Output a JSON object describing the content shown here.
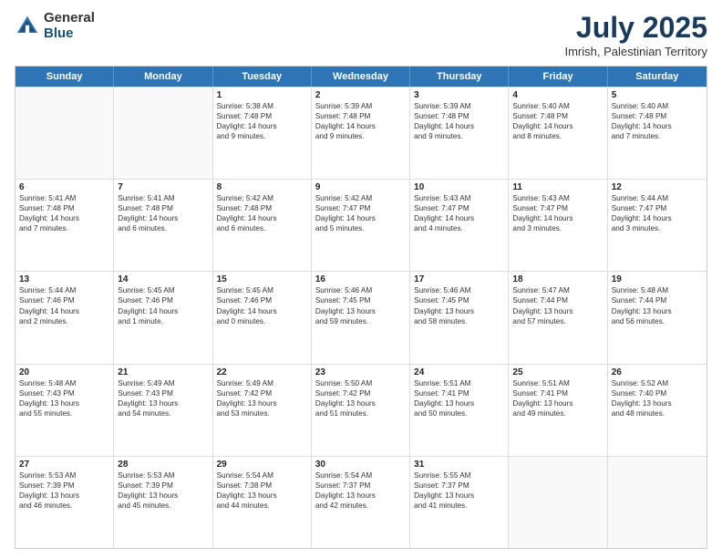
{
  "logo": {
    "general": "General",
    "blue": "Blue"
  },
  "title": "July 2025",
  "subtitle": "Imrish, Palestinian Territory",
  "headers": [
    "Sunday",
    "Monday",
    "Tuesday",
    "Wednesday",
    "Thursday",
    "Friday",
    "Saturday"
  ],
  "weeks": [
    [
      {
        "day": "",
        "lines": []
      },
      {
        "day": "",
        "lines": []
      },
      {
        "day": "1",
        "lines": [
          "Sunrise: 5:38 AM",
          "Sunset: 7:48 PM",
          "Daylight: 14 hours",
          "and 9 minutes."
        ]
      },
      {
        "day": "2",
        "lines": [
          "Sunrise: 5:39 AM",
          "Sunset: 7:48 PM",
          "Daylight: 14 hours",
          "and 9 minutes."
        ]
      },
      {
        "day": "3",
        "lines": [
          "Sunrise: 5:39 AM",
          "Sunset: 7:48 PM",
          "Daylight: 14 hours",
          "and 9 minutes."
        ]
      },
      {
        "day": "4",
        "lines": [
          "Sunrise: 5:40 AM",
          "Sunset: 7:48 PM",
          "Daylight: 14 hours",
          "and 8 minutes."
        ]
      },
      {
        "day": "5",
        "lines": [
          "Sunrise: 5:40 AM",
          "Sunset: 7:48 PM",
          "Daylight: 14 hours",
          "and 7 minutes."
        ]
      }
    ],
    [
      {
        "day": "6",
        "lines": [
          "Sunrise: 5:41 AM",
          "Sunset: 7:48 PM",
          "Daylight: 14 hours",
          "and 7 minutes."
        ]
      },
      {
        "day": "7",
        "lines": [
          "Sunrise: 5:41 AM",
          "Sunset: 7:48 PM",
          "Daylight: 14 hours",
          "and 6 minutes."
        ]
      },
      {
        "day": "8",
        "lines": [
          "Sunrise: 5:42 AM",
          "Sunset: 7:48 PM",
          "Daylight: 14 hours",
          "and 6 minutes."
        ]
      },
      {
        "day": "9",
        "lines": [
          "Sunrise: 5:42 AM",
          "Sunset: 7:47 PM",
          "Daylight: 14 hours",
          "and 5 minutes."
        ]
      },
      {
        "day": "10",
        "lines": [
          "Sunrise: 5:43 AM",
          "Sunset: 7:47 PM",
          "Daylight: 14 hours",
          "and 4 minutes."
        ]
      },
      {
        "day": "11",
        "lines": [
          "Sunrise: 5:43 AM",
          "Sunset: 7:47 PM",
          "Daylight: 14 hours",
          "and 3 minutes."
        ]
      },
      {
        "day": "12",
        "lines": [
          "Sunrise: 5:44 AM",
          "Sunset: 7:47 PM",
          "Daylight: 14 hours",
          "and 3 minutes."
        ]
      }
    ],
    [
      {
        "day": "13",
        "lines": [
          "Sunrise: 5:44 AM",
          "Sunset: 7:46 PM",
          "Daylight: 14 hours",
          "and 2 minutes."
        ]
      },
      {
        "day": "14",
        "lines": [
          "Sunrise: 5:45 AM",
          "Sunset: 7:46 PM",
          "Daylight: 14 hours",
          "and 1 minute."
        ]
      },
      {
        "day": "15",
        "lines": [
          "Sunrise: 5:45 AM",
          "Sunset: 7:46 PM",
          "Daylight: 14 hours",
          "and 0 minutes."
        ]
      },
      {
        "day": "16",
        "lines": [
          "Sunrise: 5:46 AM",
          "Sunset: 7:45 PM",
          "Daylight: 13 hours",
          "and 59 minutes."
        ]
      },
      {
        "day": "17",
        "lines": [
          "Sunrise: 5:46 AM",
          "Sunset: 7:45 PM",
          "Daylight: 13 hours",
          "and 58 minutes."
        ]
      },
      {
        "day": "18",
        "lines": [
          "Sunrise: 5:47 AM",
          "Sunset: 7:44 PM",
          "Daylight: 13 hours",
          "and 57 minutes."
        ]
      },
      {
        "day": "19",
        "lines": [
          "Sunrise: 5:48 AM",
          "Sunset: 7:44 PM",
          "Daylight: 13 hours",
          "and 56 minutes."
        ]
      }
    ],
    [
      {
        "day": "20",
        "lines": [
          "Sunrise: 5:48 AM",
          "Sunset: 7:43 PM",
          "Daylight: 13 hours",
          "and 55 minutes."
        ]
      },
      {
        "day": "21",
        "lines": [
          "Sunrise: 5:49 AM",
          "Sunset: 7:43 PM",
          "Daylight: 13 hours",
          "and 54 minutes."
        ]
      },
      {
        "day": "22",
        "lines": [
          "Sunrise: 5:49 AM",
          "Sunset: 7:42 PM",
          "Daylight: 13 hours",
          "and 53 minutes."
        ]
      },
      {
        "day": "23",
        "lines": [
          "Sunrise: 5:50 AM",
          "Sunset: 7:42 PM",
          "Daylight: 13 hours",
          "and 51 minutes."
        ]
      },
      {
        "day": "24",
        "lines": [
          "Sunrise: 5:51 AM",
          "Sunset: 7:41 PM",
          "Daylight: 13 hours",
          "and 50 minutes."
        ]
      },
      {
        "day": "25",
        "lines": [
          "Sunrise: 5:51 AM",
          "Sunset: 7:41 PM",
          "Daylight: 13 hours",
          "and 49 minutes."
        ]
      },
      {
        "day": "26",
        "lines": [
          "Sunrise: 5:52 AM",
          "Sunset: 7:40 PM",
          "Daylight: 13 hours",
          "and 48 minutes."
        ]
      }
    ],
    [
      {
        "day": "27",
        "lines": [
          "Sunrise: 5:53 AM",
          "Sunset: 7:39 PM",
          "Daylight: 13 hours",
          "and 46 minutes."
        ]
      },
      {
        "day": "28",
        "lines": [
          "Sunrise: 5:53 AM",
          "Sunset: 7:39 PM",
          "Daylight: 13 hours",
          "and 45 minutes."
        ]
      },
      {
        "day": "29",
        "lines": [
          "Sunrise: 5:54 AM",
          "Sunset: 7:38 PM",
          "Daylight: 13 hours",
          "and 44 minutes."
        ]
      },
      {
        "day": "30",
        "lines": [
          "Sunrise: 5:54 AM",
          "Sunset: 7:37 PM",
          "Daylight: 13 hours",
          "and 42 minutes."
        ]
      },
      {
        "day": "31",
        "lines": [
          "Sunrise: 5:55 AM",
          "Sunset: 7:37 PM",
          "Daylight: 13 hours",
          "and 41 minutes."
        ]
      },
      {
        "day": "",
        "lines": []
      },
      {
        "day": "",
        "lines": []
      }
    ]
  ]
}
